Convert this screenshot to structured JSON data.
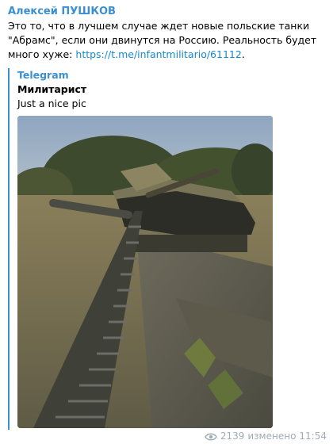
{
  "author": "Алексей ПУШКОВ",
  "message": {
    "text": "Это то, что в лучшем случае ждет новые польские танки \"Абрамс\", если они двинутся на Россию. Реальность будет много хуже:",
    "link": "https://t.me/infantmilitario/61112",
    "after_link": "."
  },
  "forwarded": {
    "source": "Telegram",
    "title": "Милитарист",
    "caption": "Just a nice pic",
    "image": "photo of a damaged tank with a detached track in a muddy field"
  },
  "footer": {
    "views": "2139",
    "edited_label": "изменено",
    "time": "11:54"
  },
  "colors": {
    "accent": "#3a8fd0",
    "link": "#168acd",
    "meta": "#a0acb6"
  }
}
